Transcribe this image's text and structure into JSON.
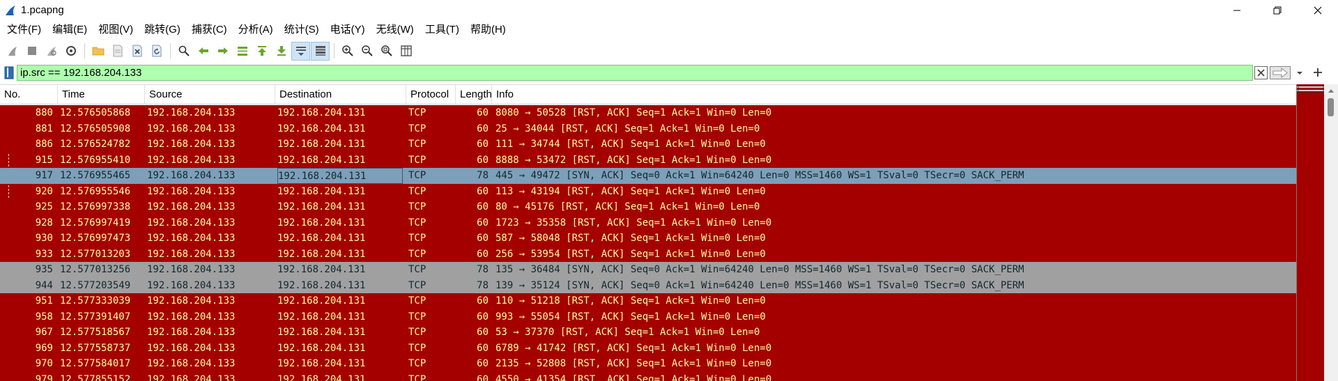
{
  "window": {
    "title": "1.pcapng"
  },
  "menu": [
    {
      "label": "文件(F)"
    },
    {
      "label": "编辑(E)"
    },
    {
      "label": "视图(V)"
    },
    {
      "label": "跳转(G)"
    },
    {
      "label": "捕获(C)"
    },
    {
      "label": "分析(A)"
    },
    {
      "label": "统计(S)"
    },
    {
      "label": "电话(Y)"
    },
    {
      "label": "无线(W)"
    },
    {
      "label": "工具(T)"
    },
    {
      "label": "帮助(H)"
    }
  ],
  "toolbar": {
    "icons": [
      "start-capture-icon",
      "stop-capture-icon",
      "restart-capture-icon",
      "capture-options-icon",
      "open-file-icon",
      "save-file-icon",
      "close-file-icon",
      "reload-file-icon",
      "find-packet-icon",
      "go-back-icon",
      "go-forward-icon",
      "go-to-packet-icon",
      "go-first-icon",
      "go-last-icon",
      "autoscroll-icon",
      "colorize-icon",
      "zoom-in-icon",
      "zoom-out-icon",
      "zoom-normal-icon",
      "resize-columns-icon"
    ]
  },
  "filter": {
    "value": "ip.src == 192.168.204.133"
  },
  "columns": {
    "no": "No.",
    "time": "Time",
    "source": "Source",
    "destination": "Destination",
    "protocol": "Protocol",
    "length": "Length",
    "info": "Info"
  },
  "colors": {
    "rst_bg": "#a40000",
    "rst_fg": "#fffc9c",
    "syn_selected_bg": "#7e9fb9",
    "syn_bg": "#a0a0a0",
    "filter_valid_bg": "#afffaf"
  },
  "packets": [
    {
      "no": "880",
      "time": "12.576505868",
      "src": "192.168.204.133",
      "dst": "192.168.204.131",
      "proto": "TCP",
      "len": "60",
      "info": "8080 → 50528 [RST, ACK] Seq=1 Ack=1 Win=0 Len=0",
      "kind": "rst"
    },
    {
      "no": "881",
      "time": "12.576505908",
      "src": "192.168.204.133",
      "dst": "192.168.204.131",
      "proto": "TCP",
      "len": "60",
      "info": "25 → 34044 [RST, ACK] Seq=1 Ack=1 Win=0 Len=0",
      "kind": "rst"
    },
    {
      "no": "886",
      "time": "12.576524782",
      "src": "192.168.204.133",
      "dst": "192.168.204.131",
      "proto": "TCP",
      "len": "60",
      "info": "111 → 34744 [RST, ACK] Seq=1 Ack=1 Win=0 Len=0",
      "kind": "rst"
    },
    {
      "no": "915",
      "time": "12.576955410",
      "src": "192.168.204.133",
      "dst": "192.168.204.131",
      "proto": "TCP",
      "len": "60",
      "info": "8888 → 53472 [RST, ACK] Seq=1 Ack=1 Win=0 Len=0",
      "kind": "rst",
      "mark": true
    },
    {
      "no": "917",
      "time": "12.576955465",
      "src": "192.168.204.133",
      "dst": "192.168.204.131",
      "proto": "TCP",
      "len": "78",
      "info": "445 → 49472 [SYN, ACK] Seq=0 Ack=1 Win=64240 Len=0 MSS=1460 WS=1 TSval=0 TSecr=0 SACK_PERM",
      "kind": "syn-sel",
      "selected": true
    },
    {
      "no": "920",
      "time": "12.576955546",
      "src": "192.168.204.133",
      "dst": "192.168.204.131",
      "proto": "TCP",
      "len": "60",
      "info": "113 → 43194 [RST, ACK] Seq=1 Ack=1 Win=0 Len=0",
      "kind": "rst",
      "mark": true
    },
    {
      "no": "925",
      "time": "12.576997338",
      "src": "192.168.204.133",
      "dst": "192.168.204.131",
      "proto": "TCP",
      "len": "60",
      "info": "80 → 45176 [RST, ACK] Seq=1 Ack=1 Win=0 Len=0",
      "kind": "rst"
    },
    {
      "no": "928",
      "time": "12.576997419",
      "src": "192.168.204.133",
      "dst": "192.168.204.131",
      "proto": "TCP",
      "len": "60",
      "info": "1723 → 35358 [RST, ACK] Seq=1 Ack=1 Win=0 Len=0",
      "kind": "rst"
    },
    {
      "no": "930",
      "time": "12.576997473",
      "src": "192.168.204.133",
      "dst": "192.168.204.131",
      "proto": "TCP",
      "len": "60",
      "info": "587 → 58048 [RST, ACK] Seq=1 Ack=1 Win=0 Len=0",
      "kind": "rst"
    },
    {
      "no": "933",
      "time": "12.577013203",
      "src": "192.168.204.133",
      "dst": "192.168.204.131",
      "proto": "TCP",
      "len": "60",
      "info": "256 → 53954 [RST, ACK] Seq=1 Ack=1 Win=0 Len=0",
      "kind": "rst"
    },
    {
      "no": "935",
      "time": "12.577013256",
      "src": "192.168.204.133",
      "dst": "192.168.204.131",
      "proto": "TCP",
      "len": "78",
      "info": "135 → 36484 [SYN, ACK] Seq=0 Ack=1 Win=64240 Len=0 MSS=1460 WS=1 TSval=0 TSecr=0 SACK_PERM",
      "kind": "syn"
    },
    {
      "no": "944",
      "time": "12.577203549",
      "src": "192.168.204.133",
      "dst": "192.168.204.131",
      "proto": "TCP",
      "len": "78",
      "info": "139 → 35124 [SYN, ACK] Seq=0 Ack=1 Win=64240 Len=0 MSS=1460 WS=1 TSval=0 TSecr=0 SACK_PERM",
      "kind": "syn"
    },
    {
      "no": "951",
      "time": "12.577333039",
      "src": "192.168.204.133",
      "dst": "192.168.204.131",
      "proto": "TCP",
      "len": "60",
      "info": "110 → 51218 [RST, ACK] Seq=1 Ack=1 Win=0 Len=0",
      "kind": "rst"
    },
    {
      "no": "958",
      "time": "12.577391407",
      "src": "192.168.204.133",
      "dst": "192.168.204.131",
      "proto": "TCP",
      "len": "60",
      "info": "993 → 55054 [RST, ACK] Seq=1 Ack=1 Win=0 Len=0",
      "kind": "rst"
    },
    {
      "no": "967",
      "time": "12.577518567",
      "src": "192.168.204.133",
      "dst": "192.168.204.131",
      "proto": "TCP",
      "len": "60",
      "info": "53 → 37370 [RST, ACK] Seq=1 Ack=1 Win=0 Len=0",
      "kind": "rst"
    },
    {
      "no": "969",
      "time": "12.577558737",
      "src": "192.168.204.133",
      "dst": "192.168.204.131",
      "proto": "TCP",
      "len": "60",
      "info": "6789 → 41742 [RST, ACK] Seq=1 Ack=1 Win=0 Len=0",
      "kind": "rst"
    },
    {
      "no": "970",
      "time": "12.577584017",
      "src": "192.168.204.133",
      "dst": "192.168.204.131",
      "proto": "TCP",
      "len": "60",
      "info": "2135 → 52808 [RST, ACK] Seq=1 Ack=1 Win=0 Len=0",
      "kind": "rst"
    },
    {
      "no": "979",
      "time": "12.577855152",
      "src": "192.168.204.133",
      "dst": "192.168.204.131",
      "proto": "TCP",
      "len": "60",
      "info": "4550 → 41354 [RST, ACK] Seq=1 Ack=1 Win=0 Len=0",
      "kind": "rst"
    }
  ]
}
